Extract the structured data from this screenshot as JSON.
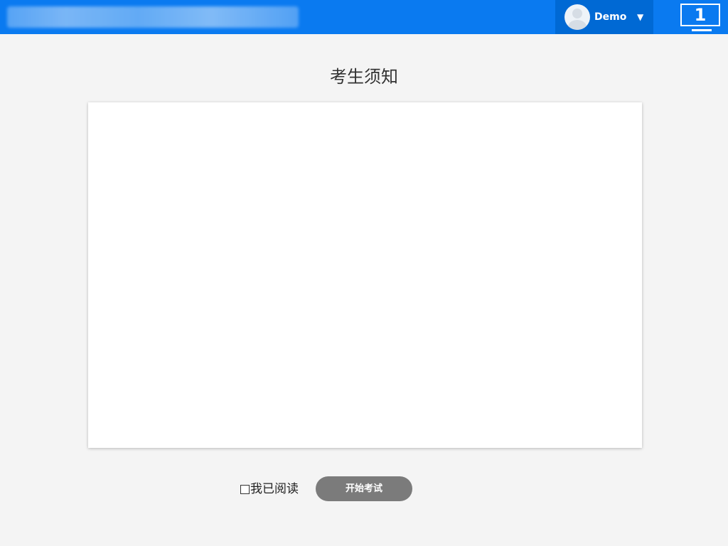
{
  "header": {
    "user": {
      "name": "Demo",
      "avatar_icon": "user-avatar-icon",
      "dropdown_icon": "caret-down-icon",
      "dropdown_glyph": "▼"
    },
    "screen_button": {
      "label": "1",
      "icon": "monitor-icon"
    }
  },
  "main": {
    "title": "考生须知",
    "notice_content": ""
  },
  "footer": {
    "read_checkbox": {
      "label": "我已阅读",
      "checked": false
    },
    "start_button": {
      "label": "开始考试",
      "enabled": false
    }
  },
  "colors": {
    "header_bg": "#0a7af0",
    "user_box_bg": "#0069d4",
    "page_bg": "#f4f4f4",
    "button_disabled_bg": "#7b7b7b"
  }
}
